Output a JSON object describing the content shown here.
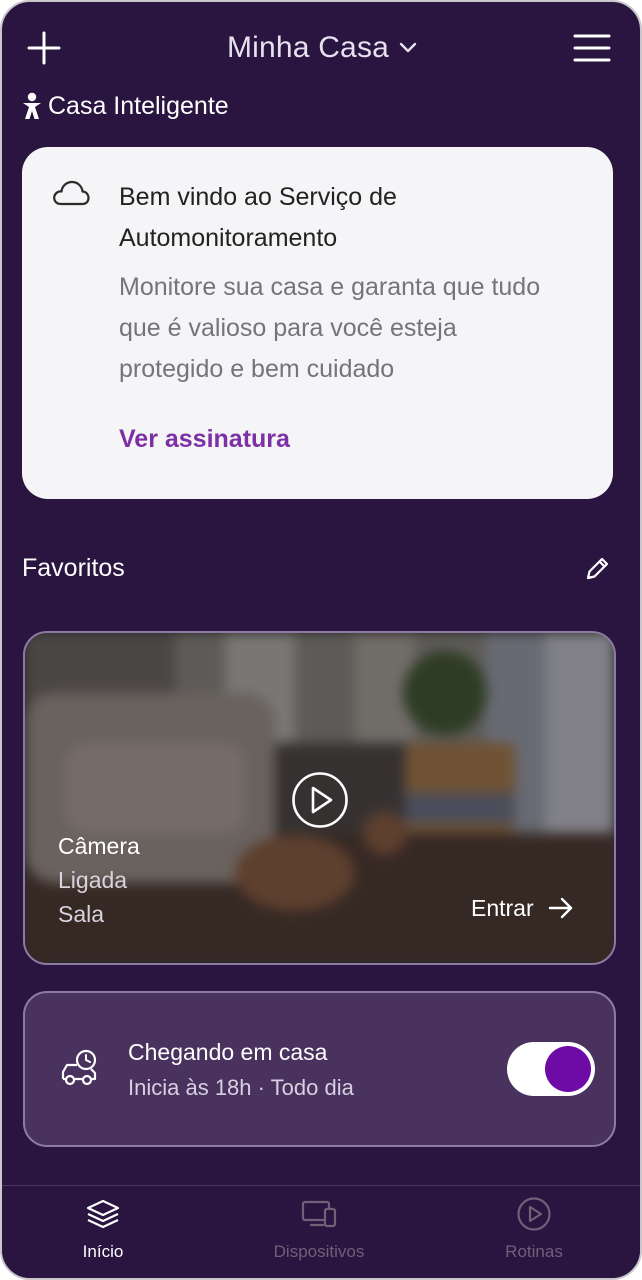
{
  "header": {
    "title": "Minha Casa",
    "add_icon": "plus-icon",
    "menu_icon": "hamburger-menu-icon",
    "dropdown_icon": "chevron-down-icon"
  },
  "section": {
    "label": "Casa Inteligente",
    "icon": "person-icon"
  },
  "welcome_card": {
    "icon": "cloud-icon",
    "title": "Bem vindo ao Serviço de Automonitoramento",
    "description": "Monitore sua casa e garanta que tudo que é valioso para você esteja protegido e bem cuidado",
    "link": "Ver assinatura",
    "link_color": "#7d2fa5"
  },
  "favorites": {
    "title": "Favoritos",
    "edit_icon": "pencil-icon",
    "camera": {
      "name": "Câmera",
      "status": "Ligada",
      "room": "Sala",
      "action": "Entrar",
      "play_icon": "play-icon",
      "arrow_icon": "arrow-right-icon"
    },
    "routine": {
      "title": "Chegando em casa",
      "subtitle": "Inicia às 18h · Todo dia",
      "icon": "car-clock-icon",
      "enabled": true,
      "toggle_color": "#6e0aa5"
    }
  },
  "bottom_nav": {
    "items": [
      {
        "label": "Início",
        "icon": "layers-icon",
        "active": true
      },
      {
        "label": "Dispositivos",
        "icon": "devices-icon",
        "active": false
      },
      {
        "label": "Rotinas",
        "icon": "play-circle-icon",
        "active": false
      }
    ]
  },
  "colors": {
    "background": "#2a1440",
    "card": "#f5f4f7",
    "routine_card": "#4a325f"
  }
}
